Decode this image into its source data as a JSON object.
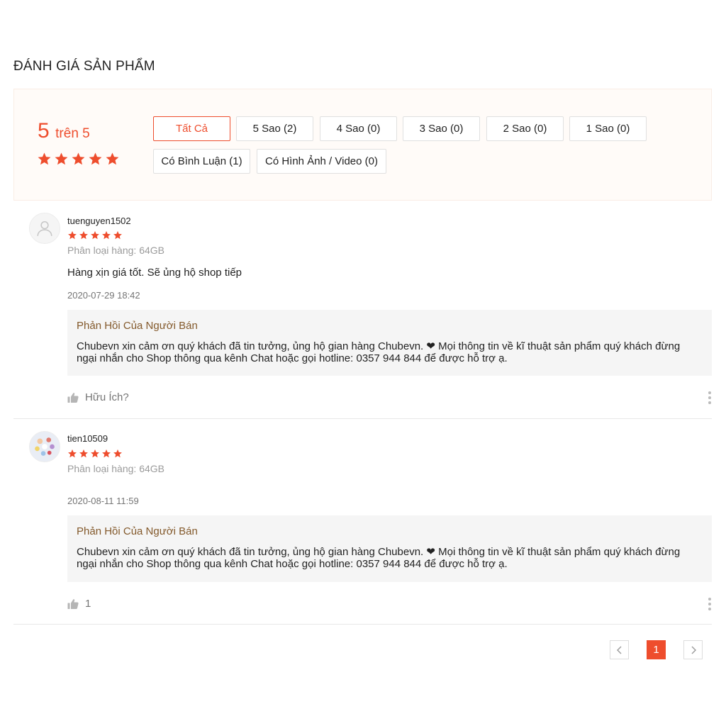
{
  "section": {
    "title": "ĐÁNH GIÁ SẢN PHẨM"
  },
  "overview": {
    "score": "5",
    "score_suffix": "trên 5",
    "rating_stars": 5,
    "filters": [
      {
        "label": "Tất Cả",
        "active": true
      },
      {
        "label": "5 Sao (2)",
        "active": false
      },
      {
        "label": "4 Sao (0)",
        "active": false
      },
      {
        "label": "3 Sao (0)",
        "active": false
      },
      {
        "label": "2 Sao (0)",
        "active": false
      },
      {
        "label": "1 Sao (0)",
        "active": false
      },
      {
        "label": "Có Bình Luận (1)",
        "active": false
      },
      {
        "label": "Có Hình Ảnh / Video (0)",
        "active": false
      }
    ]
  },
  "reviews": [
    {
      "username": "tuenguyen1502",
      "rating_stars": 5,
      "variation": "Phân loại hàng: 64GB",
      "comment": "Hàng xịn giá tốt. Sẽ ủng hộ shop tiếp",
      "timestamp": "2020-07-29 18:42",
      "reply_title": "Phản Hồi Của Người Bán",
      "reply_body": "Chubevn xin cảm ơn quý khách đã tin tưởng, ủng hộ gian hàng Chubevn. ❤ Mọi thông tin về kĩ thuật sản phẩm quý khách đừng ngại nhắn cho Shop thông qua kênh Chat hoặc gọi hotline: 0357 944 844 để được hỗ trợ ạ.",
      "like_label": "Hữu Ích?"
    },
    {
      "username": "tien10509",
      "rating_stars": 5,
      "variation": "Phân loại hàng: 64GB",
      "comment": "",
      "timestamp": "2020-08-11 11:59",
      "reply_title": "Phản Hồi Của Người Bán",
      "reply_body": "Chubevn xin cảm ơn quý khách đã tin tưởng, ủng hộ gian hàng Chubevn. ❤ Mọi thông tin về kĩ thuật sản phẩm quý khách đừng ngại nhắn cho Shop thông qua kênh Chat hoặc gọi hotline: 0357 944 844 để được hỗ trợ ạ.",
      "like_label": "1"
    }
  ],
  "pagination": {
    "prev_icon": "chevron-left-icon",
    "current_page": "1",
    "next_icon": "chevron-right-icon"
  },
  "colors": {
    "accent": "#ee4d2d",
    "reply_title": "#83592b"
  }
}
